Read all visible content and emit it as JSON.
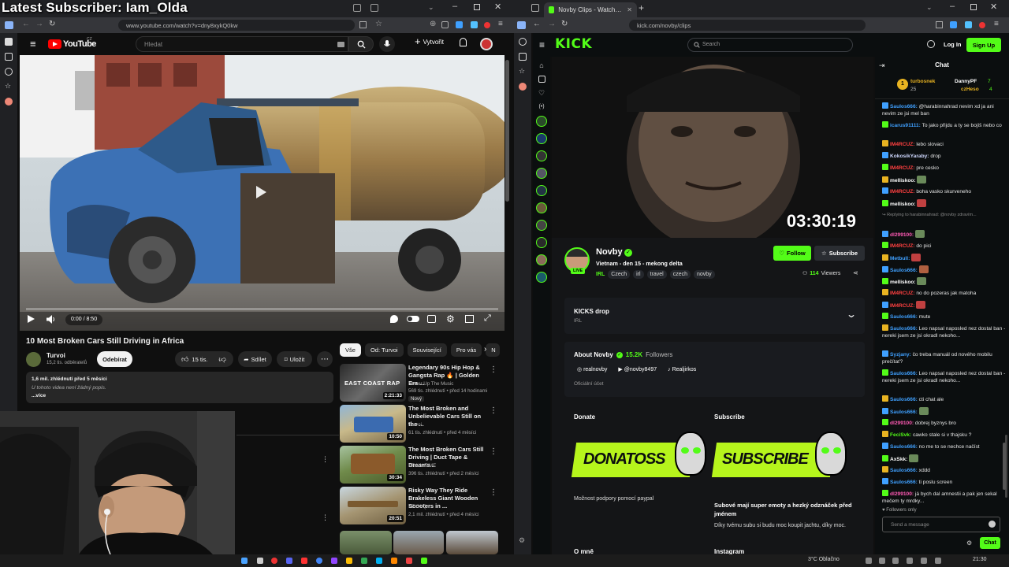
{
  "overlay": {
    "title": "Latest Subscriber: Iam_Olda"
  },
  "left_browser": {
    "url": "www.youtube.com/watch?v=dny8xykQ0kw"
  },
  "youtube": {
    "logo_text": "YouTube",
    "logo_region": "CZ",
    "search_placeholder": "Hledat",
    "create_label": "Vytvořit",
    "player": {
      "time": "0:00 / 8:50"
    },
    "video_title": "10 Most Broken Cars Still Driving in Africa",
    "channel_name": "Turvoi",
    "subscribers": "15,2 tis. odběratelů",
    "subscribe_label": "Odebírat",
    "likes": "15 tis.",
    "share_label": "Sdílet",
    "save_label": "Uložit",
    "description": {
      "stats": "1,6 mil. zhlédnutí  před 5 měsíci",
      "text": "U tohoto videa není žádný popis.",
      "more": "...více"
    },
    "chips": [
      "Vše",
      "Od: Turvoi",
      "Související",
      "Pro vás",
      "N"
    ],
    "recommended": [
      {
        "title": "Legendary 90s Hip Hop & Gangsta Rap 🔥 | Golden Era ...",
        "channel": "Power Up The Music",
        "meta": "569 tis. zhlédnutí • před 14 hodinami",
        "badge": "Nový",
        "duration": "2:21:33",
        "thumb_text": "EAST COAST RAP"
      },
      {
        "title": "The Most Broken and Unbelievable Cars Still on the ...",
        "channel": "Turvoi",
        "meta": "61 tis. zhlédnutí • před 4 měsíci",
        "duration": "10:50"
      },
      {
        "title": "The Most Broken Cars Still Driving | Duct Tape & Dreams...",
        "channel": "BRAIN TIME",
        "meta": "396 tis. zhlédnutí • před 2 měsíci",
        "duration": "30:34"
      },
      {
        "title": "Risky Way They Ride Brakeless Giant Wooden Scooters in ...",
        "channel": "TEKNIQ",
        "meta": "2,1 mil. zhlédnutí • před 4 měsíci",
        "duration": "20:51"
      }
    ]
  },
  "right_browser": {
    "tab_title": "Novby Clips - Watch Live o...",
    "url": "kick.com/novby/clips"
  },
  "kick": {
    "logo": "KICK",
    "search_placeholder": "Search",
    "login_label": "Log In",
    "signup_label": "Sign Up",
    "timer": "03:30:19",
    "streamer_name": "Novby",
    "stream_title": "Vietnam - den 15 - mekong delta",
    "live_badge": "LIVE",
    "tags": [
      "IRL",
      "Czech",
      "irl",
      "travel",
      "czech",
      "novby"
    ],
    "follow_label": "Follow",
    "subscribe_label": "Subscribe",
    "viewers_count": "114",
    "viewers_label": "Viewers",
    "drop_title": "KICKS drop",
    "drop_sub": "IRL",
    "about_title": "About Novby",
    "followers_count": "15.2K",
    "followers_label": "Followers",
    "socials": [
      "realnovby",
      "@novby8497",
      "Realjirkos"
    ],
    "official_label": "Oficiální účet",
    "panels": {
      "donate_heading": "Donate",
      "donate_banner": "DONATOSS",
      "donate_text": "Možnost podpory pomocí paypal",
      "subscribe_heading": "Subscribe",
      "subscribe_banner": "SUBSCRIBE",
      "subscribe_text_bold": "Subové mají super emoty a hezký odznáček před jménem",
      "subscribe_text": "Díky tvému subu si budu moc koupit jachtu, díky moc.",
      "about_me": "O mně",
      "instagram": "Instagram"
    }
  },
  "chat": {
    "title": "Chat",
    "top_gifters": [
      {
        "name": "turbosnek",
        "count": "25"
      },
      {
        "name": "DannyPF",
        "count": "7"
      },
      {
        "name": "czHeso",
        "count": "4"
      }
    ],
    "messages": [
      {
        "user": "Saulos666:",
        "text": "@harabinnahrad nevim xd ja ani nevim ze jsi mel ban",
        "color": "#3fa0ff"
      },
      {
        "user": "icarus91111:",
        "text": "To jako přijdu a ty se bojíš nebo co",
        "color": "#3fa0ff"
      },
      {
        "user": "IM4RCUZ:",
        "text": "lebo slovaci",
        "color": "#ff4040"
      },
      {
        "user": "KokosikYaraby:",
        "text": "drop",
        "color": "#cfd8ff"
      },
      {
        "user": "IM4RCUZ:",
        "text": "pre cesko",
        "color": "#ff4040"
      },
      {
        "user": "melliskoo:",
        "text": "",
        "color": "#ffffff"
      },
      {
        "user": "IM4RCUZ:",
        "text": "boha vasko skurveneho",
        "color": "#ff4040"
      },
      {
        "user": "melliskoo:",
        "text": "",
        "color": "#ffffff"
      },
      {
        "user": "↪ Replying to harabinnahrad: @novby zdravím...",
        "text": "",
        "color": "#888888"
      },
      {
        "user": "dl299100:",
        "text": "",
        "color": "#ff5ab4"
      },
      {
        "user": "IM4RCUZ:",
        "text": "do pici",
        "color": "#ff4040"
      },
      {
        "user": "Metbull:",
        "text": "",
        "color": "#3fa0ff"
      },
      {
        "user": "Saulos666:",
        "text": "",
        "color": "#3fa0ff"
      },
      {
        "user": "melliskoo:",
        "text": "",
        "color": "#ffffff"
      },
      {
        "user": "IM4RCUZ:",
        "text": "no do pozeras jak matoha",
        "color": "#ff4040"
      },
      {
        "user": "IM4RCUZ:",
        "text": "",
        "color": "#ff4040"
      },
      {
        "user": "Saulos666:",
        "text": "mute",
        "color": "#3fa0ff"
      },
      {
        "user": "Saulos666:",
        "text": "Leo napsal naposled nez dostal ban - nereki jsem ze jsi okradl nekoho...",
        "color": "#3fa0ff"
      },
      {
        "user": "Syzjany:",
        "text": "čo treba manuál od nového mobilu prečítať?",
        "color": "#3fa0ff"
      },
      {
        "user": "Saulos666:",
        "text": "Leo napsal naposled nez dostal ban - nereki jsem ze jsi okradl nekoho...",
        "color": "#3fa0ff"
      },
      {
        "user": "Saulos666:",
        "text": "cti chat ale",
        "color": "#3fa0ff"
      },
      {
        "user": "Saulos666:",
        "text": "",
        "color": "#3fa0ff"
      },
      {
        "user": "dl299100:",
        "text": "dobrej byznys bro",
        "color": "#ff5ab4"
      },
      {
        "user": "FeciSvk:",
        "text": "cawko stale si v thajsku ?",
        "color": "#53fc18"
      },
      {
        "user": "Saulos666:",
        "text": "no me to se nechce načíst",
        "color": "#3fa0ff"
      },
      {
        "user": "AxSkk:",
        "text": "",
        "color": "#ffffff"
      },
      {
        "user": "Saulos666:",
        "text": "xddd",
        "color": "#3fa0ff"
      },
      {
        "user": "Saulos666:",
        "text": "ti poslu screen",
        "color": "#3fa0ff"
      },
      {
        "user": "dl299100:",
        "text": "já bych dal amnestii a pak jen sekal mečem ty mrdky...",
        "color": "#ff5ab4"
      }
    ],
    "followers_only": "Followers only",
    "input_placeholder": "Send a message",
    "send_label": "Chat"
  },
  "taskbar": {
    "weather": "3°C  Oblačno",
    "time": "21:30"
  }
}
